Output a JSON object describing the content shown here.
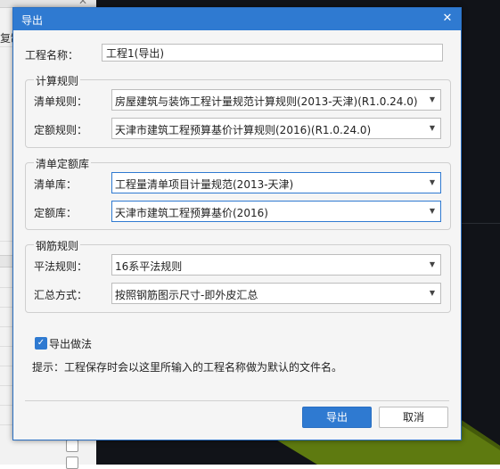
{
  "background": {
    "copy_label": "复制",
    "close_glyph": "✕"
  },
  "dialog": {
    "title": "导出",
    "close_glyph": "✕",
    "project_name": {
      "label": "工程名称：",
      "value": "工程1(导出)"
    },
    "calc_rules": {
      "legend": "计算规则",
      "bill_rule": {
        "label": "清单规则：",
        "value": "房屋建筑与装饰工程计量规范计算规则(2013-天津)(R1.0.24.0)"
      },
      "quota_rule": {
        "label": "定额规则：",
        "value": "天津市建筑工程预算基价计算规则(2016)(R1.0.24.0)"
      }
    },
    "bill_quota_lib": {
      "legend": "清单定额库",
      "bill_lib": {
        "label": "清单库：",
        "value": "工程量清单项目计量规范(2013-天津)"
      },
      "quota_lib": {
        "label": "定额库：",
        "value": "天津市建筑工程预算基价(2016)"
      }
    },
    "rebar_rules": {
      "legend": "钢筋规则",
      "flat_rule": {
        "label": "平法规则：",
        "value": "16系平法规则"
      },
      "summary_method": {
        "label": "汇总方式：",
        "value": "按照钢筋图示尺寸-即外皮汇总"
      }
    },
    "export_method": {
      "label": "导出做法",
      "checked": true
    },
    "hint": "提示：工程保存时会以这里所输入的工程名称做为默认的文件名。",
    "buttons": {
      "export": "导出",
      "cancel": "取消"
    }
  },
  "colors": {
    "accent": "#2f7ad1",
    "canvas": "#111318",
    "green_plane": "#5e7a10"
  },
  "icons": {
    "dropdown": "chevron-down-icon",
    "check": "check-icon",
    "close": "close-icon"
  }
}
